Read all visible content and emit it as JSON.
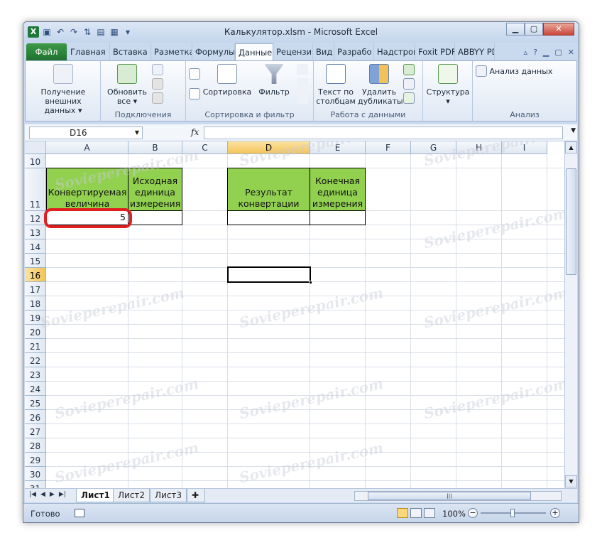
{
  "window": {
    "title": "Калькулятор.xlsm - Microsoft Excel"
  },
  "quick_access": [
    "excel-logo-icon",
    "save-icon",
    "undo-icon",
    "redo-icon",
    "sort-icon",
    "form-icon",
    "calculator-icon",
    "customize-icon"
  ],
  "tabs": [
    {
      "label": "Файл"
    },
    {
      "label": "Главная"
    },
    {
      "label": "Вставка"
    },
    {
      "label": "Разметка"
    },
    {
      "label": "Формулы"
    },
    {
      "label": "Данные"
    },
    {
      "label": "Рецензи"
    },
    {
      "label": "Вид"
    },
    {
      "label": "Разрабо"
    },
    {
      "label": "Надстрой"
    },
    {
      "label": "Foxit PDF"
    },
    {
      "label": "ABBYY PD"
    }
  ],
  "ribbon": {
    "get_data": {
      "line1": "Получение",
      "line2": "внешних данных"
    },
    "refresh": {
      "line1": "Обновить",
      "line2": "все"
    },
    "connections_label": "Подключения",
    "sort": "Сортировка",
    "filter": "Фильтр",
    "sort_filter_label": "Сортировка и фильтр",
    "text_to_cols": {
      "line1": "Текст по",
      "line2": "столбцам"
    },
    "remove_dups": {
      "line1": "Удалить",
      "line2": "дубликаты"
    },
    "data_tools_label": "Работа с данными",
    "structure": "Структура",
    "analysis_data": "Анализ данных",
    "analysis_label": "Анализ"
  },
  "formula_bar": {
    "name_box": "D16",
    "fx": "fx",
    "formula": ""
  },
  "grid": {
    "columns": [
      "A",
      "B",
      "C",
      "D",
      "E",
      "F",
      "G",
      "H",
      "I"
    ],
    "selected_column": "D",
    "rows": [
      "10",
      "11",
      "12",
      "13",
      "14",
      "15",
      "16",
      "17",
      "18",
      "19",
      "20",
      "21",
      "22",
      "23",
      "24",
      "25",
      "26",
      "27",
      "28",
      "29",
      "30",
      "31"
    ],
    "selected_row": "16",
    "cells": {
      "A11": "Конвертируемая величина",
      "B11": "Исходная единица измерения",
      "D11": "Результат конвертации",
      "E11": "Конечная единица измерения",
      "A12": "5",
      "B12": "",
      "D12": "",
      "E12": ""
    },
    "fill_color": "#92d050",
    "highlight_color": "#e02020"
  },
  "sheets": [
    {
      "label": "Лист1",
      "active": true
    },
    {
      "label": "Лист2"
    },
    {
      "label": "Лист3"
    }
  ],
  "status": {
    "text": "Готово",
    "zoom": "100%"
  }
}
